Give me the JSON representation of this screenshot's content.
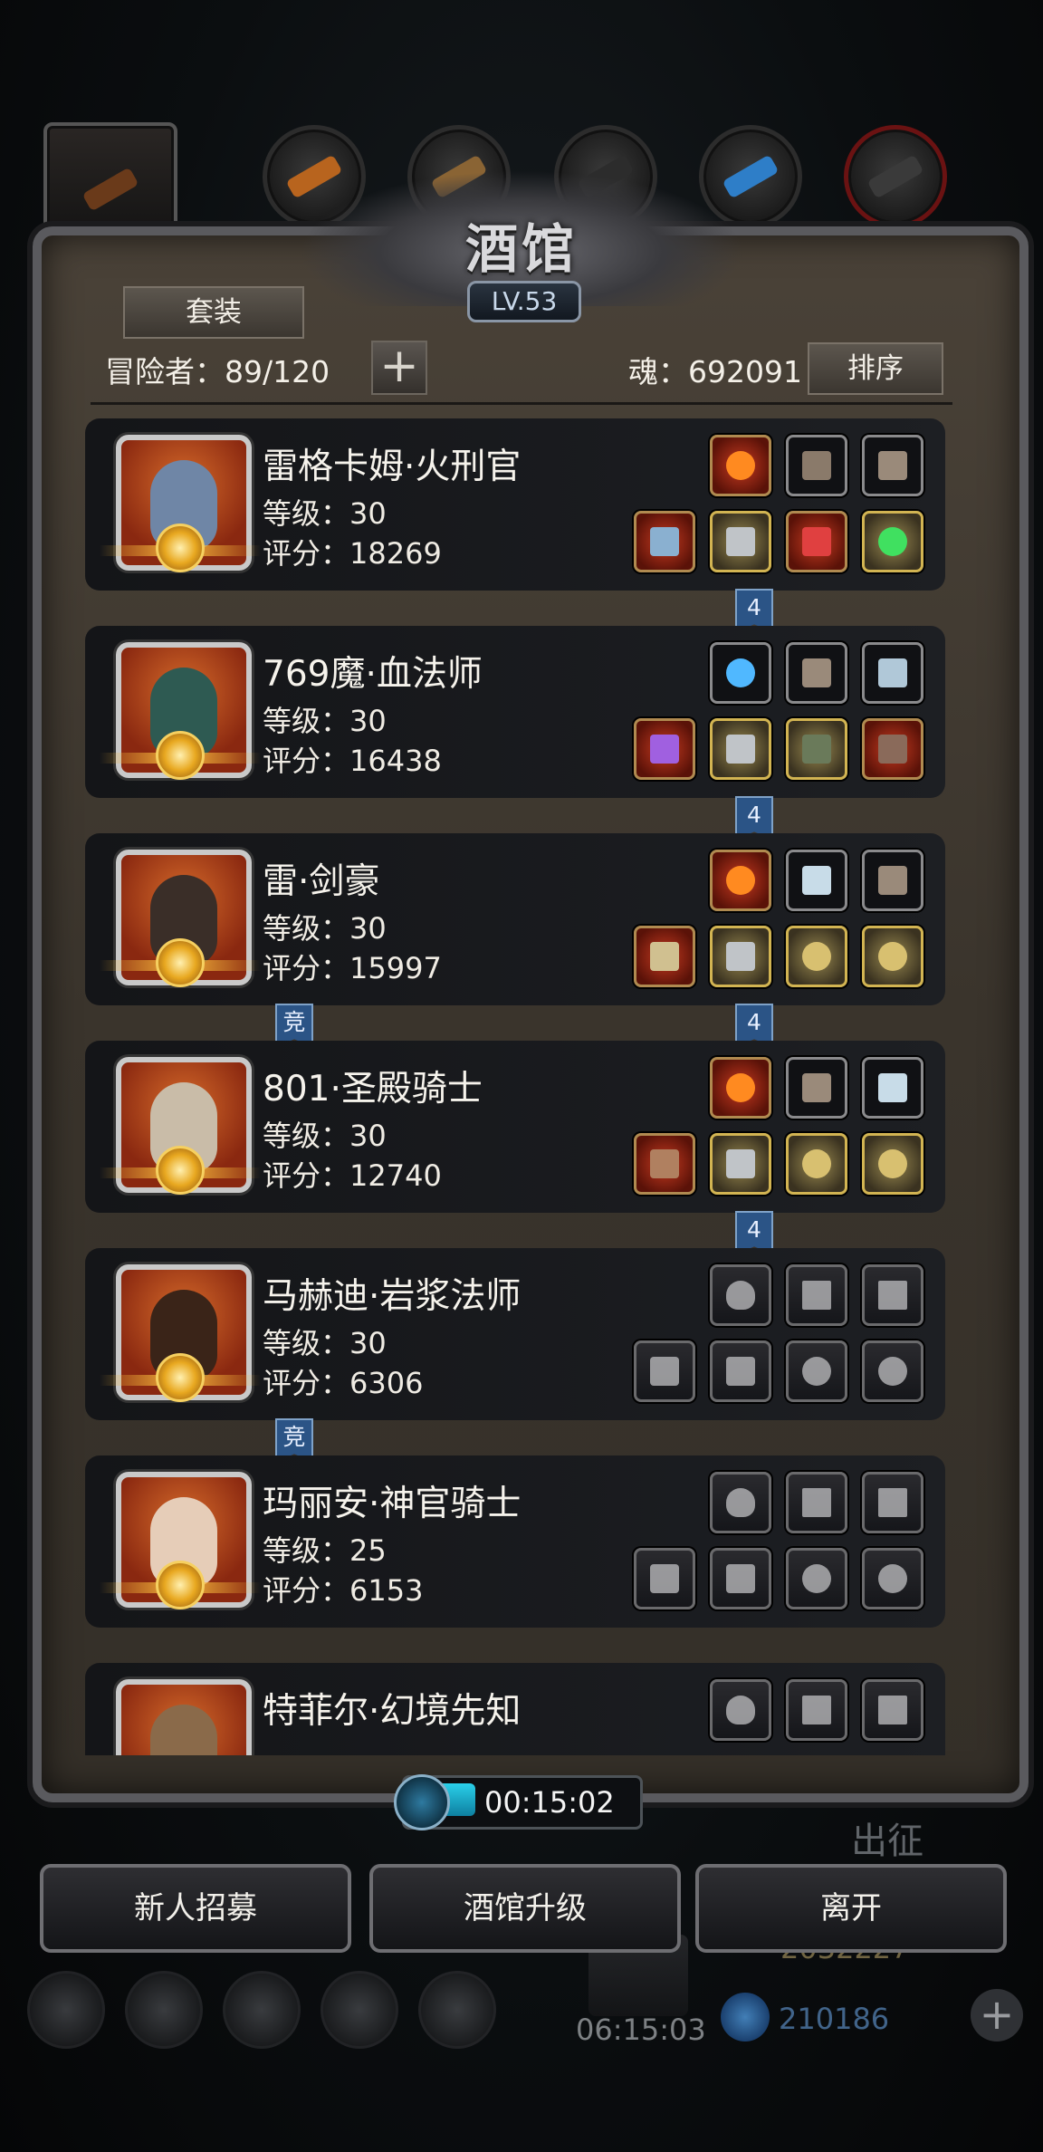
{
  "header": {
    "title": "酒馆",
    "level": "LV.53",
    "set_label": "套装",
    "adventurers": "冒险者：89/120",
    "plus": "+",
    "soul": "魂：692091",
    "sort_label": "排序"
  },
  "heroes": [
    {
      "name": "雷格卡姆·火刑官",
      "level": "等级：30",
      "score": "评分：18269",
      "face_color": "#6f86a6",
      "top_slots": [
        "fire",
        "gloves",
        "bracer"
      ],
      "bottom_slots": [
        "axe",
        "armor",
        "amulet",
        "gem"
      ],
      "link": "4"
    },
    {
      "name": "769魔·血法师",
      "level": "等级：30",
      "score": "评分：16438",
      "face_color": "#2e5a52",
      "top_slots": [
        "orb",
        "bracer",
        "necklace"
      ],
      "bottom_slots": [
        "staff",
        "armor",
        "cloak",
        "book"
      ],
      "link": "4"
    },
    {
      "name": "雷·剑豪",
      "level": "等级：30",
      "score": "评分：15997",
      "face_color": "#3a2e28",
      "top_slots": [
        "fire",
        "rune",
        "bracer"
      ],
      "bottom_slots": [
        "sword",
        "armor",
        "ring",
        "ring"
      ],
      "link": "4",
      "left_link": "竞"
    },
    {
      "name": "801·圣殿骑士",
      "level": "等级：30",
      "score": "评分：12740",
      "face_color": "#c9bca8",
      "top_slots": [
        "fire",
        "bracer",
        "rune"
      ],
      "bottom_slots": [
        "hammer",
        "armor",
        "ring",
        "ring"
      ],
      "link": "4"
    },
    {
      "name": "马赫迪·岩浆法师",
      "level": "等级：30",
      "score": "评分：6306",
      "face_color": "#3a2418",
      "top_slots": [
        "empty",
        "empty",
        "empty"
      ],
      "bottom_slots": [
        "empty",
        "empty",
        "empty",
        "empty"
      ],
      "left_link": "竞"
    },
    {
      "name": "玛丽安·神官骑士",
      "level": "等级：25",
      "score": "评分：6153",
      "face_color": "#e6cdb8",
      "top_slots": [
        "empty",
        "empty",
        "empty"
      ],
      "bottom_slots": [
        "empty",
        "empty",
        "empty",
        "empty"
      ]
    },
    {
      "name": "特菲尔·幻境先知",
      "level": "",
      "score": "",
      "face_color": "#8a6a4a",
      "top_slots": [
        "empty",
        "empty",
        "empty"
      ],
      "bottom_slots": []
    }
  ],
  "timer": {
    "text": "00:15:02",
    "progress": 0.3
  },
  "actions": {
    "recruit": "新人招募",
    "upgrade": "酒馆升级",
    "leave": "离开"
  },
  "background": {
    "expedition": "出征",
    "gold": "2032227",
    "gems": "210186",
    "timer": "06:15:03",
    "plus": "+"
  }
}
